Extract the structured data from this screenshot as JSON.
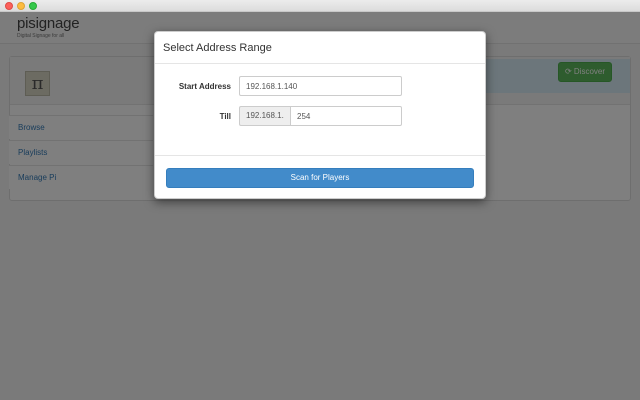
{
  "app": {
    "logo_text": "pisignage",
    "logo_tagline": "Digital Signage for all",
    "avatar_symbol": "π",
    "discover_label": "Discover",
    "nav": [
      {
        "label": "Browse"
      },
      {
        "label": "Playlists"
      },
      {
        "label": "Manage Pi"
      }
    ]
  },
  "modal": {
    "title": "Select Address Range",
    "start_label": "Start Address",
    "start_value": "192.168.1.140",
    "till_label": "Till",
    "till_prefix": "192.168.1.",
    "till_value": "254",
    "scan_label": "Scan for Players"
  },
  "colors": {
    "primary": "#428bca",
    "success": "#5cb85c"
  }
}
